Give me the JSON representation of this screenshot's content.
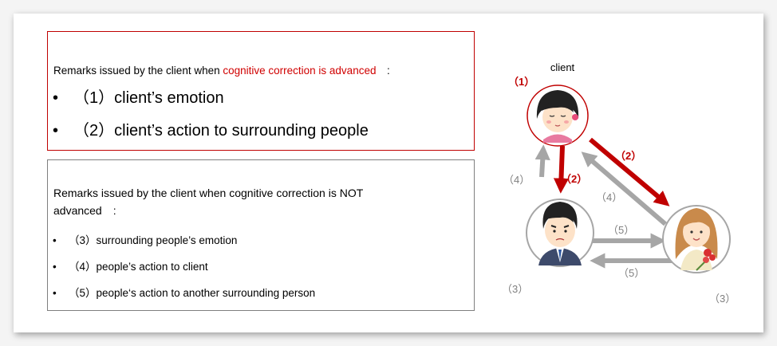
{
  "advanced_box": {
    "intro_prefix": "Remarks issued by the client when ",
    "intro_highlight": "cognitive correction is advanced",
    "intro_suffix": "　:",
    "items": [
      "（1）client’s emotion",
      "（2）client’s action to surrounding people"
    ]
  },
  "not_advanced_box": {
    "intro": "Remarks issued by the client when cognitive correction is NOT advanced　:",
    "items": [
      "（3）surrounding people’s emotion",
      "（4）people’s action to client",
      "（5）people‘s action to another surrounding person"
    ]
  },
  "bullet": "•",
  "diagram": {
    "client_label": "client",
    "label_1": "（1）",
    "label_2": "（2）",
    "label_3": "（3）",
    "label_4": "（4）",
    "label_5": "（5）",
    "colors": {
      "red": "#c00000",
      "gray": "#a6a6a6"
    }
  }
}
